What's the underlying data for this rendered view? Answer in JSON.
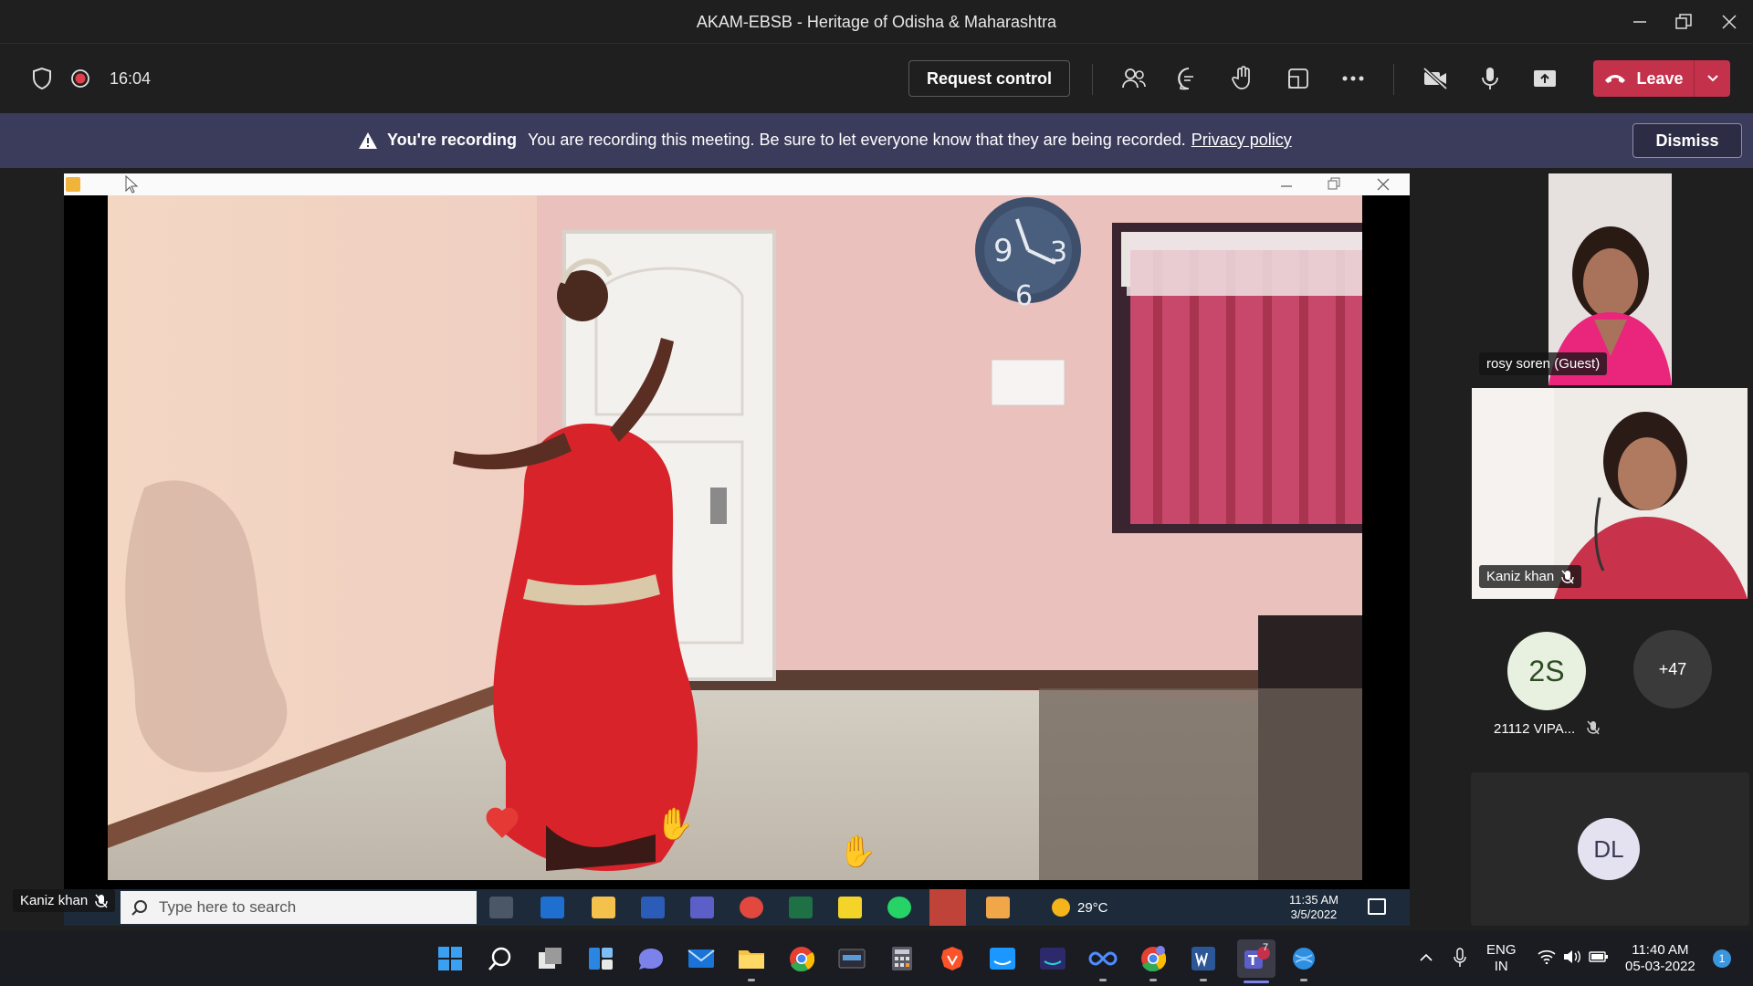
{
  "window": {
    "title": "AKAM-EBSB - Heritage of Odisha & Maharashtra"
  },
  "toolbar": {
    "timer": "16:04",
    "request_control": "Request control",
    "leave": "Leave",
    "icons": [
      "shield-icon",
      "recording-icon",
      "people-icon",
      "chat-icon",
      "raise-hand-icon",
      "rooms-icon",
      "more-icon",
      "camera-off-icon",
      "mic-icon",
      "share-icon"
    ]
  },
  "banner": {
    "title": "You're recording",
    "message": "You are recording this meeting. Be sure to let everyone know that they are being recorded.",
    "link": "Privacy policy",
    "dismiss": "Dismiss"
  },
  "shared_screen": {
    "presenter": "Kaniz khan",
    "inner_taskbar": {
      "search_placeholder": "Type here to search",
      "weather": "29°C",
      "time": "11:35 AM",
      "date": "3/5/2022"
    }
  },
  "participants": {
    "rosy": {
      "name": "rosy soren (Guest)"
    },
    "kaniz": {
      "name": "Kaniz khan"
    },
    "p2s": {
      "initials": "2S",
      "name": "21112 VIPA..."
    },
    "more": {
      "count": "+47"
    },
    "dl": {
      "initials": "DL"
    }
  },
  "taskbar": {
    "lang": "ENG",
    "region": "IN",
    "time": "11:40 AM",
    "date": "05-03-2022",
    "notifications": "1",
    "teams_badge": "7"
  },
  "colors": {
    "leave": "#c4314b",
    "banner": "#3b3c5c",
    "avatar_2s": "#e8f1e0",
    "avatar_dl": "#e4e2f0"
  }
}
